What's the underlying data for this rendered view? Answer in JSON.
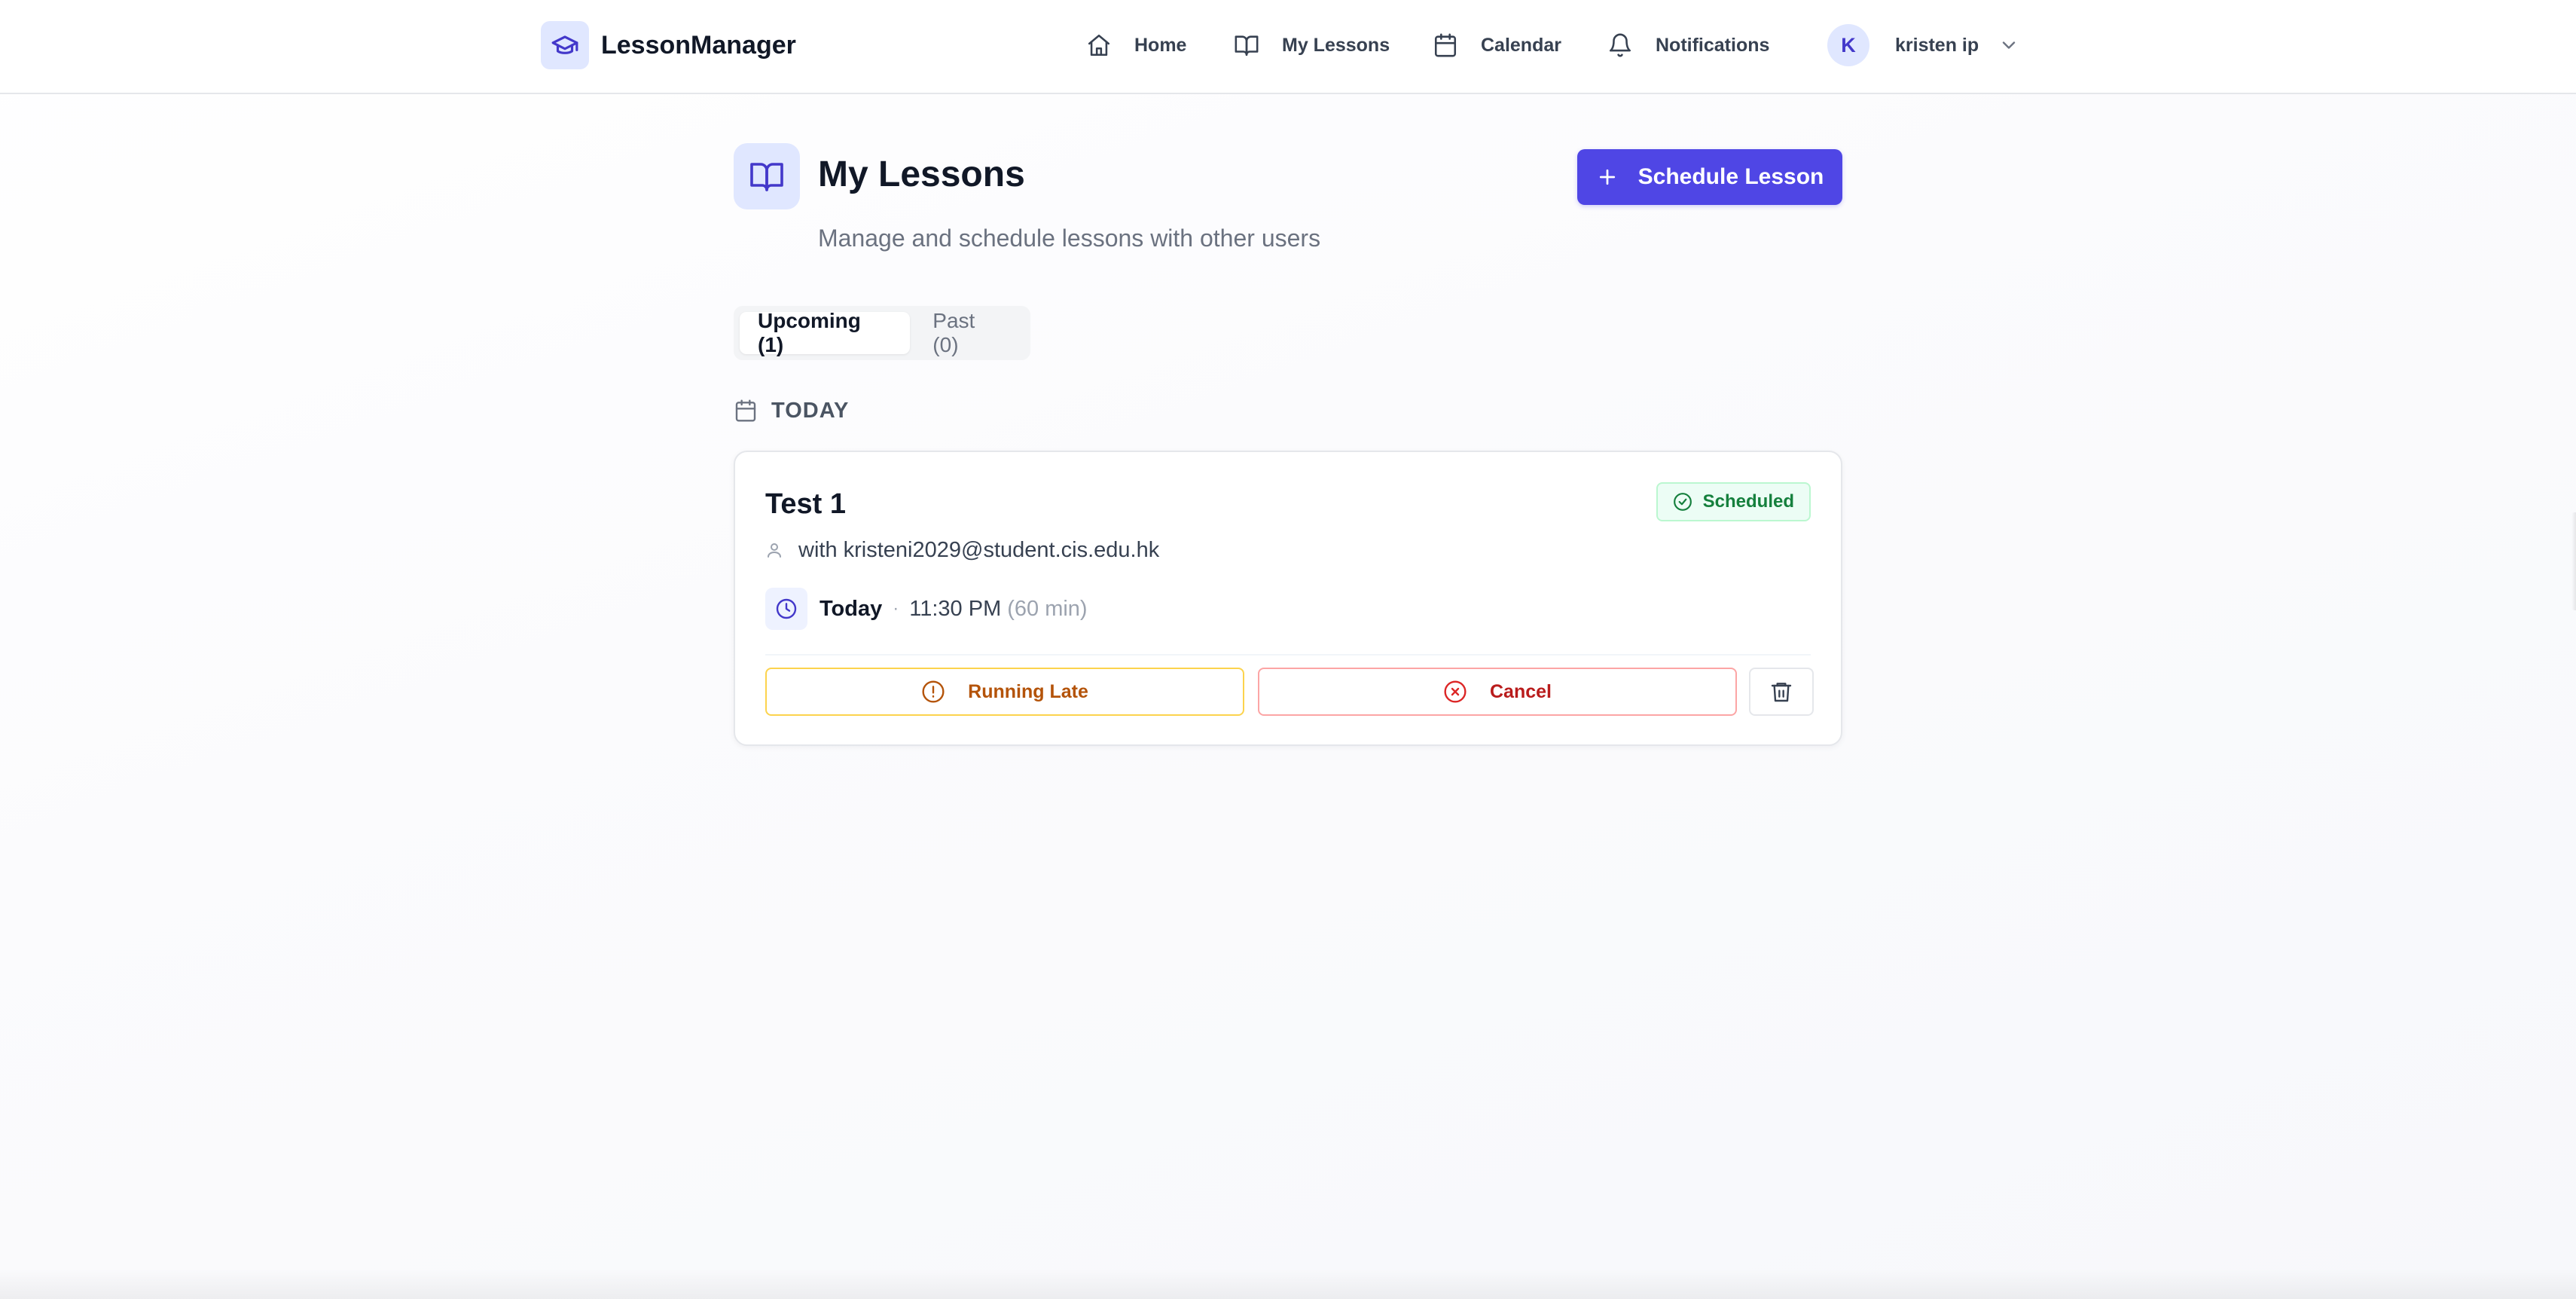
{
  "brand": {
    "name": "LessonManager",
    "icon": "graduation-cap-icon",
    "accent": "#4f46e5"
  },
  "nav": {
    "items": [
      {
        "label": "Home",
        "icon": "home-icon"
      },
      {
        "label": "My Lessons",
        "icon": "book-icon"
      },
      {
        "label": "Calendar",
        "icon": "calendar-icon"
      },
      {
        "label": "Notifications",
        "icon": "bell-icon"
      }
    ]
  },
  "user": {
    "initial": "K",
    "name": "kristen ip",
    "menu_icon": "chevron-down-icon"
  },
  "page": {
    "title": "My Lessons",
    "subtitle": "Manage and schedule lessons with other users",
    "icon": "book-open-icon"
  },
  "actions": {
    "schedule_label": "Schedule Lesson",
    "schedule_icon": "plus-icon"
  },
  "tabs": [
    {
      "label": "Upcoming (1)",
      "active": true
    },
    {
      "label": "Past (0)",
      "active": false
    }
  ],
  "section": {
    "label": "TODAY",
    "icon": "calendar-icon"
  },
  "lesson": {
    "title": "Test 1",
    "status": "Scheduled",
    "status_color": "#15803d",
    "participant": "with kristeni2029@student.cis.edu.hk",
    "day": "Today",
    "separator": "·",
    "time": "11:30 PM",
    "duration": "(60 min)",
    "late_label": "Running Late",
    "cancel_label": "Cancel",
    "delete_icon": "trash-icon"
  }
}
